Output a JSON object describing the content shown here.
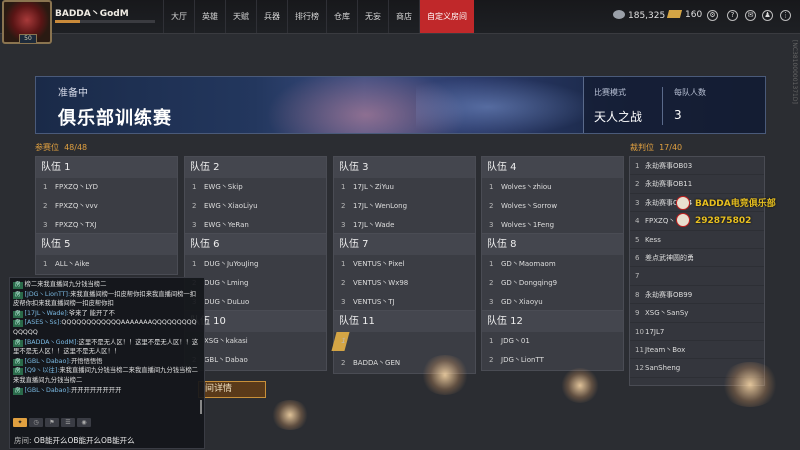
{
  "header": {
    "player_name": "BADDA丶GodM",
    "avatar_level": "50",
    "xp_fraction": 0.25,
    "nav": [
      "大厅",
      "英雄",
      "天赋",
      "兵器",
      "排行榜",
      "仓库",
      "无妄",
      "商店",
      "自定义房间"
    ],
    "active_nav": "自定义房间",
    "silver": "185,325",
    "gold": "160",
    "side_code": "[NC381000001371D]"
  },
  "banner": {
    "status": "准备中",
    "title": "俱乐部训练赛",
    "mode_label": "比赛模式",
    "mode_value": "天人之战",
    "size_label": "每队人数",
    "size_value": "3"
  },
  "participants_label": "参赛位",
  "participants_count": "48/48",
  "referees_label": "裁判位",
  "referees_count": "17/40",
  "teams": [
    {
      "name": "队伍 1",
      "players": [
        {
          "n": "1",
          "name": "FPXZQ丶LYD"
        },
        {
          "n": "2",
          "name": "FPXZQ丶vvv"
        },
        {
          "n": "3",
          "name": "FPXZQ丶TXJ"
        }
      ]
    },
    {
      "name": "队伍 2",
      "players": [
        {
          "n": "1",
          "name": "EWG丶Skip"
        },
        {
          "n": "2",
          "name": "EWG丶XiaoLiyu"
        },
        {
          "n": "3",
          "name": "EWG丶YeRan"
        }
      ]
    },
    {
      "name": "队伍 3",
      "players": [
        {
          "n": "1",
          "name": "17JL丶ZiYuu"
        },
        {
          "n": "2",
          "name": "17JL丶WenLong"
        },
        {
          "n": "3",
          "name": "17JL丶Wade"
        }
      ]
    },
    {
      "name": "队伍 4",
      "players": [
        {
          "n": "1",
          "name": "Wolves丶zhiou"
        },
        {
          "n": "2",
          "name": "Wolves丶Sorrow"
        },
        {
          "n": "3",
          "name": "Wolves丶1Feng"
        }
      ]
    },
    {
      "name": "队伍 5",
      "players": [
        {
          "n": "1",
          "name": "ALL丶Aike"
        }
      ]
    },
    {
      "name": "队伍 6",
      "players": [
        {
          "n": "1",
          "name": "DUG丶JuYouJing"
        },
        {
          "n": "2",
          "name": "DUG丶Lming"
        },
        {
          "n": "3",
          "name": "DUG丶DuLuo"
        }
      ]
    },
    {
      "name": "队伍 7",
      "players": [
        {
          "n": "1",
          "name": "VENTUS丶Pixel"
        },
        {
          "n": "2",
          "name": "VENTUS丶Wx98"
        },
        {
          "n": "3",
          "name": "VENTUS丶TJ"
        }
      ]
    },
    {
      "name": "队伍 8",
      "players": [
        {
          "n": "1",
          "name": "GD丶Maomaom"
        },
        {
          "n": "2",
          "name": "GD丶Dongqing9"
        },
        {
          "n": "3",
          "name": "GD丶Xiaoyu"
        }
      ]
    },
    {
      "name": "队伍 10",
      "players": [
        {
          "n": "1",
          "name": "XSG丶kakasi"
        },
        {
          "n": "2",
          "name": "GBL丶Dabao"
        }
      ]
    },
    {
      "name": "队伍 11",
      "players": [
        {
          "n": "1",
          "name": "BADDA丶GodM",
          "hl": true
        },
        {
          "n": "2",
          "name": "BADDA丶GEN"
        }
      ]
    },
    {
      "name": "队伍 12",
      "players": [
        {
          "n": "1",
          "name": "JDG丶01"
        },
        {
          "n": "2",
          "name": "JDG丶LionTT"
        }
      ]
    }
  ],
  "referees": [
    {
      "n": "1",
      "name": "永劫赛事OB03"
    },
    {
      "n": "2",
      "name": "永劫赛事OB11"
    },
    {
      "n": "3",
      "name": "永劫赛事OB04"
    },
    {
      "n": "4",
      "name": "FPXZQ丶"
    },
    {
      "n": "5",
      "name": "Kess"
    },
    {
      "n": "6",
      "name": "差点武神圆的勇"
    },
    {
      "n": "7",
      "name": ""
    },
    {
      "n": "8",
      "name": "永劫赛事OB99"
    },
    {
      "n": "9",
      "name": "XSG丶SanSy"
    },
    {
      "n": "10",
      "name": "17JL7"
    },
    {
      "n": "11",
      "name": "Jteam丶Box"
    },
    {
      "n": "12",
      "name": "SanSheng"
    }
  ],
  "watermark": {
    "line1": "BADDA电竞俱乐部",
    "line2": "292875802"
  },
  "chat": {
    "messages": [
      {
        "tag": "房",
        "who": "",
        "text": "榜二来我直播间九分钱当榜二"
      },
      {
        "tag": "房",
        "who": "[JDG丶LionTT]:",
        "text": "来我直播间榜一扣皮帮你扣来我直播间榜一扣皮帮你扣来我直播间榜一扣皮帮你扣"
      },
      {
        "tag": "房",
        "who": "[17JL丶Wade]:",
        "text": "爷来了 能开了不"
      },
      {
        "tag": "房",
        "who": "[ASES丶Ss]:",
        "text": "QQQQQQQQQQQQAAAAAAAQQQQQQQQQQQQQQ"
      },
      {
        "tag": "房",
        "who": "[BADDA丶GodM]:",
        "text": "这里不是无人区！！这里不是无人区！！这里不是无人区！！这里不是无人区！！"
      },
      {
        "tag": "房",
        "who": "[GBL丶Dabao]:",
        "text": "开悟悟悟悟"
      },
      {
        "tag": "房",
        "who": "[Q9丶以往]:",
        "text": "来我直播间九分钱当榜二来我直播间九分钱当榜二来我直播间九分钱当榜二"
      },
      {
        "tag": "房",
        "who": "[GBL丶Dabao]:",
        "text": "开开开开开开开开"
      }
    ],
    "input_label": "房间:",
    "input_value": "OB能开么OB能开么OB能开么"
  },
  "detail_button": "间详情"
}
